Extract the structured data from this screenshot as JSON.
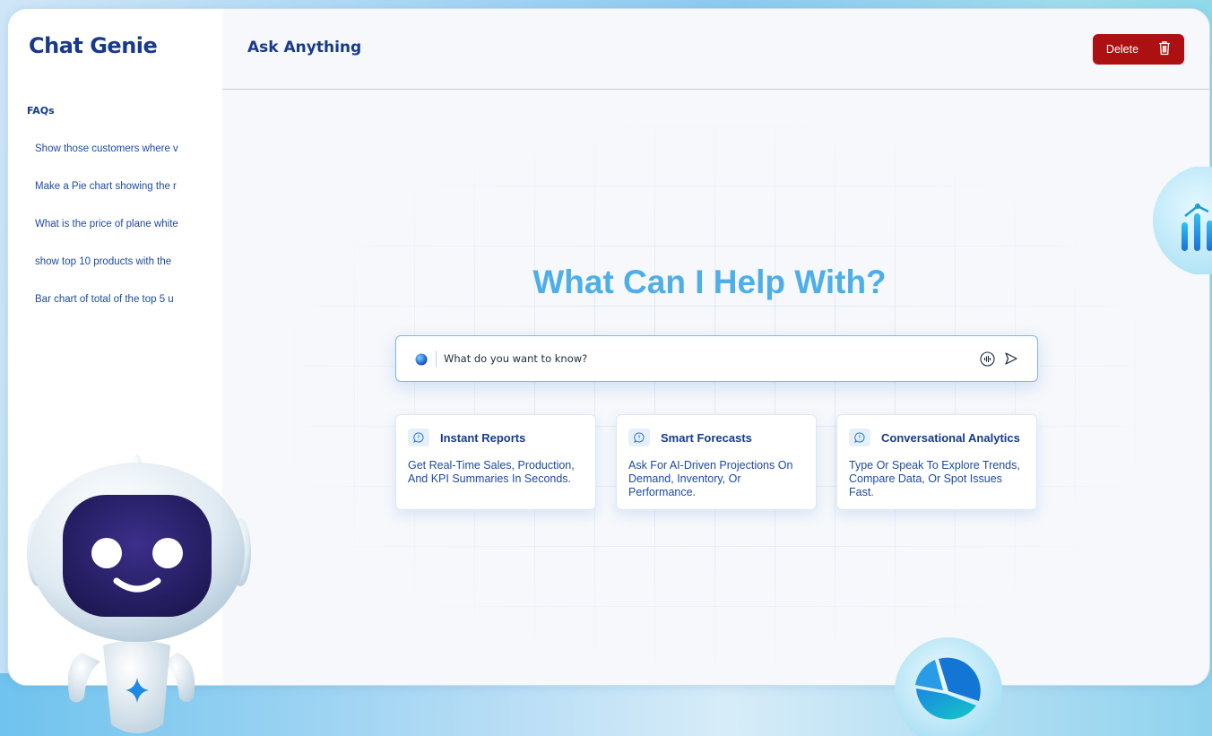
{
  "brand": "Chat Genie",
  "sidebar": {
    "faq_title": "FAQs",
    "items": [
      {
        "label": "Show those customers where v"
      },
      {
        "label": "Make a Pie chart showing the r"
      },
      {
        "label": "What is the price of plane white"
      },
      {
        "label": "show top 10 products with the"
      },
      {
        "label": "Bar chart of total of the top 5 u"
      }
    ]
  },
  "header": {
    "title": "Ask Anything",
    "delete_label": "Delete",
    "delete_icon": "trash-icon"
  },
  "main": {
    "hero": "What Can I Help With?",
    "search": {
      "placeholder": "What do you want to know?",
      "icons": [
        "orb-icon",
        "voice-icon",
        "send-icon"
      ]
    },
    "cards": [
      {
        "title": "Instant Reports",
        "desc": "Get Real-Time Sales, Production, And KPI Summaries In Seconds.",
        "icon": "chat-info-icon"
      },
      {
        "title": "Smart Forecasts",
        "desc": "Ask For AI-Driven Projections On Demand, Inventory, Or Performance.",
        "icon": "chat-info-icon"
      },
      {
        "title": "Conversational Analytics",
        "desc": "Type Or Speak To Explore Trends, Compare Data, Or Spot Issues Fast.",
        "icon": "chat-info-icon"
      }
    ]
  },
  "colors": {
    "brand": "#173a8a",
    "accent": "#4eaee8",
    "danger": "#ad1010"
  }
}
